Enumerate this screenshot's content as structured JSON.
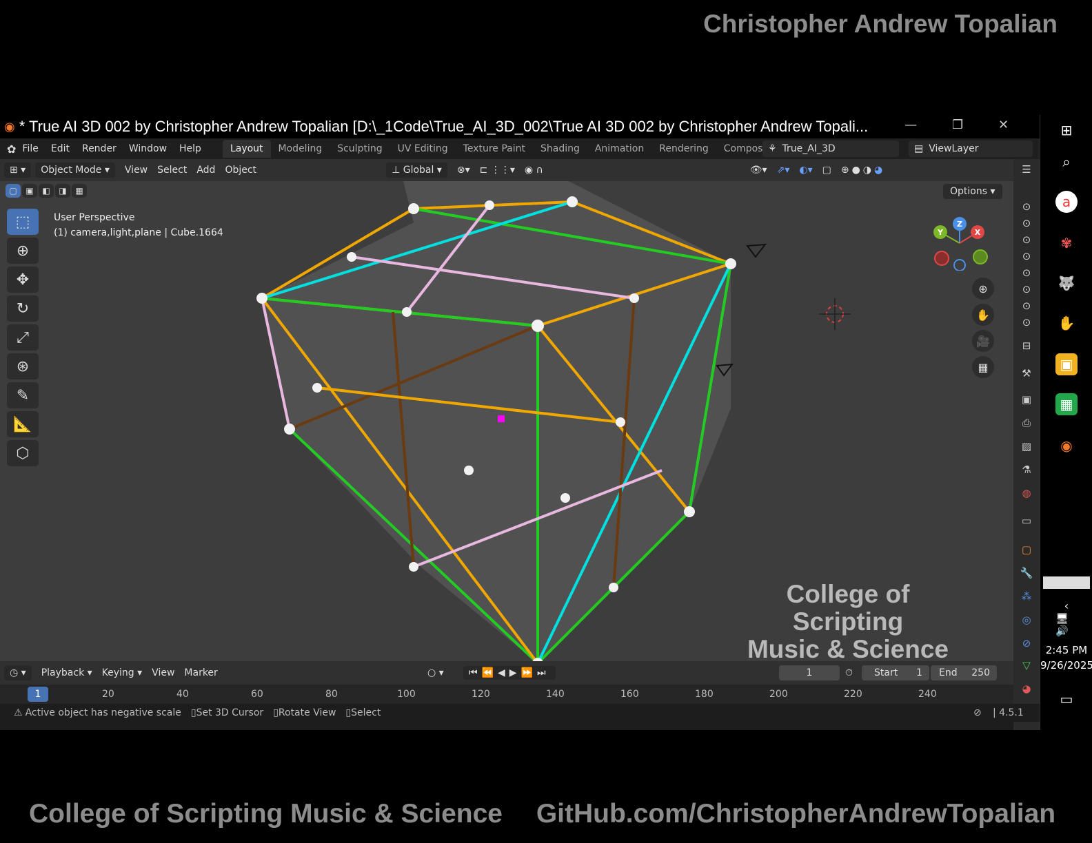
{
  "banners": {
    "top": "Christopher Andrew Topalian",
    "bottom_left": "College of Scripting Music & Science",
    "bottom_right": "GitHub.com/ChristopherAndrewTopalian"
  },
  "window": {
    "title": "* True AI 3D 002 by Christopher Andrew Topalian [D:\\_1Code\\True_AI_3D_002\\True AI 3D 002 by Christopher Andrew Topali..."
  },
  "menu": {
    "file": "File",
    "edit": "Edit",
    "render": "Render",
    "window": "Window",
    "help": "Help"
  },
  "workspaces": [
    "Layout",
    "Modeling",
    "Sculpting",
    "UV Editing",
    "Texture Paint",
    "Shading",
    "Animation",
    "Rendering",
    "Compositin"
  ],
  "scene": {
    "name": "True_AI_3D",
    "view_layer": "ViewLayer"
  },
  "viewport_header": {
    "mode": "Object Mode",
    "view": "View",
    "select": "Select",
    "add": "Add",
    "object": "Object",
    "orientation": "Global"
  },
  "viewport": {
    "perspective": "User Perspective",
    "collection_info": "(1) camera,light,plane | Cube.1664",
    "options": "Options",
    "watermark_line1": "College of Scripting",
    "watermark_line2": "Music & Science",
    "gizmo": {
      "x": "X",
      "y": "Y",
      "z": "Z"
    }
  },
  "timeline": {
    "playback": "Playback",
    "keying": "Keying",
    "view": "View",
    "marker": "Marker",
    "current_frame": "1",
    "start_label": "Start",
    "start": "1",
    "end_label": "End",
    "end": "250",
    "ruler_current": "1",
    "ruler_ticks": [
      "20",
      "40",
      "60",
      "80",
      "100",
      "120",
      "140",
      "160",
      "180",
      "200",
      "220",
      "240"
    ]
  },
  "status": {
    "warning": "Active object has negative scale",
    "set_cursor": "Set 3D Cursor",
    "rotate_view": "Rotate View",
    "select": "Select",
    "version": "4.5.1"
  },
  "taskbar": {
    "time": "2:45 PM",
    "date": "9/26/2025"
  },
  "colors": {
    "accent": "#4772b3",
    "green": "#22cc22",
    "orange": "#f0a800",
    "cyan": "#00e0e0",
    "pink": "#e8b8e0",
    "brown": "#6a3a10"
  }
}
